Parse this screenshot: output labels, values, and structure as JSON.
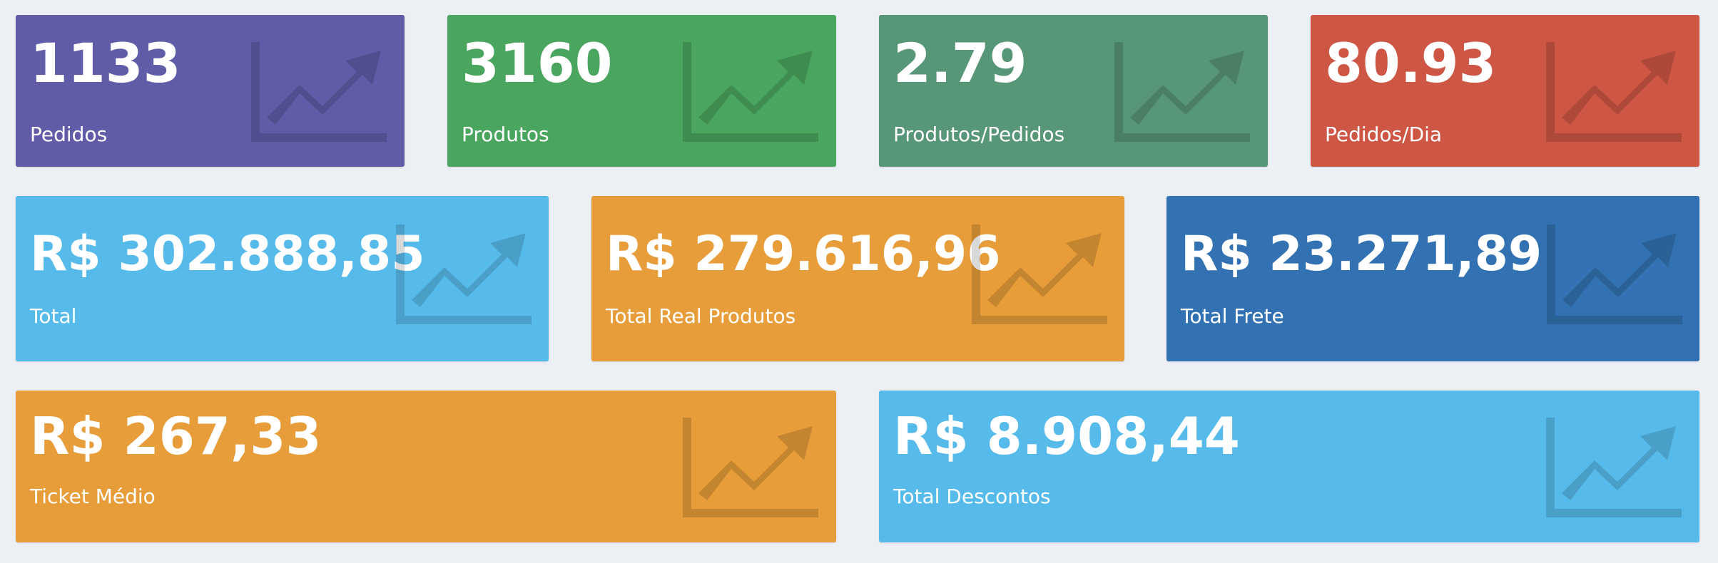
{
  "boxes": [
    {
      "value": "1133",
      "label": "Pedidos",
      "color": "#605ca8",
      "icon": "chart-line-icon"
    },
    {
      "value": "3160",
      "label": "Produtos",
      "color": "#4aa55f",
      "icon": "chart-line-icon"
    },
    {
      "value": "2.79",
      "label": "Produtos/Pedidos",
      "color": "#579677",
      "icon": "chart-line-icon"
    },
    {
      "value": "80.93",
      "label": "Pedidos/Dia",
      "color": "#cd5645",
      "icon": "chart-line-icon"
    },
    {
      "value": "R$ 302.888,85",
      "label": "Total",
      "color": "#56bbea",
      "icon": "chart-line-icon"
    },
    {
      "value": "R$ 279.616,96",
      "label": "Total Real Produtos",
      "color": "#e79d39",
      "icon": "chart-line-icon"
    },
    {
      "value": "R$ 23.271,89",
      "label": "Total Frete",
      "color": "#3272b2",
      "icon": "chart-line-icon"
    },
    {
      "value": "R$ 267,33",
      "label": "Ticket Médio",
      "color": "#e79d39",
      "icon": "chart-line-icon"
    },
    {
      "value": "R$ 8.908,44",
      "label": "Total Descontos",
      "color": "#56bbea",
      "icon": "chart-line-icon"
    }
  ]
}
